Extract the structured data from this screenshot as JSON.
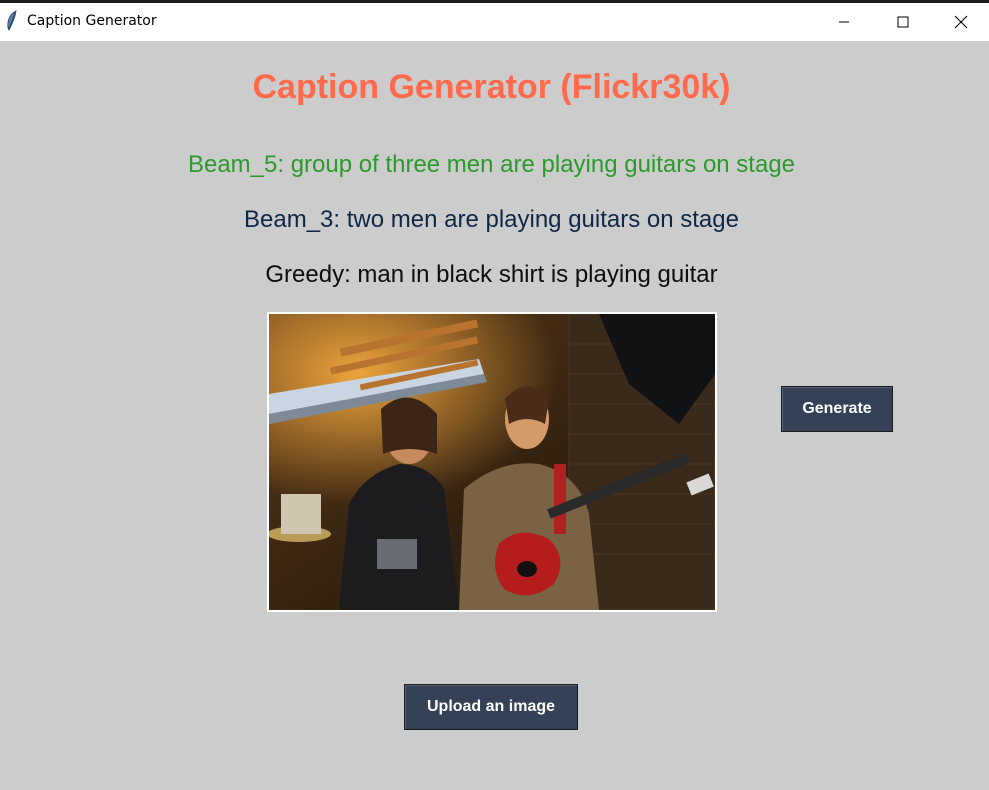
{
  "window": {
    "title": "Caption Generator",
    "icons": {
      "app": "feather-icon",
      "minimize": "minimize-icon",
      "maximize": "maximize-icon",
      "close": "close-icon"
    }
  },
  "main": {
    "heading": "Caption Generator (Flickr30k)",
    "captions": [
      {
        "label": "Beam_5: group of three men are playing guitars on stage",
        "color": "#2b9a2b"
      },
      {
        "label": "Beam_3: two men are playing guitars on stage",
        "color": "#0f2745"
      },
      {
        "label": "Greedy: man in black shirt is playing guitar",
        "color": "#0d0d0d"
      }
    ],
    "generate_label": "Generate",
    "upload_label": "Upload an image"
  },
  "colors": {
    "background": "#cccccc",
    "heading": "#ff6a4d",
    "button": "#354157",
    "button_text": "#ffffff"
  }
}
